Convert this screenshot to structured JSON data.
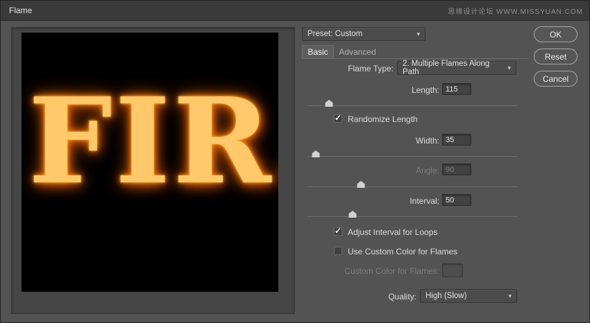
{
  "titlebar": {
    "title": "Flame",
    "watermark": "思缘设计论坛 WWW.MISSYUAN.COM"
  },
  "preview": {
    "flame_text": "FIR.."
  },
  "panel": {
    "preset": "Preset: Custom",
    "tabs": {
      "basic": "Basic",
      "advanced": "Advanced"
    },
    "flame_type": {
      "label": "Flame Type:",
      "value": "2. Multiple Flames Along Path"
    },
    "length": {
      "label": "Length:",
      "value": "115",
      "slider": 10.3
    },
    "randomize_length": {
      "label": "Randomize Length",
      "checked": true
    },
    "width": {
      "label": "Width:",
      "value": "35",
      "slider": 4
    },
    "angle": {
      "label": "Angle:",
      "value": "90",
      "slider": 25.5
    },
    "interval": {
      "label": "Interval:",
      "value": "50",
      "slider": 21.5
    },
    "adjust_interval": {
      "label": "Adjust Interval for Loops",
      "checked": true
    },
    "use_custom_color": {
      "label": "Use Custom Color for Flames",
      "checked": false
    },
    "custom_color": {
      "label": "Custom Color for Flames:"
    },
    "quality": {
      "label": "Quality:",
      "value": "High (Slow)"
    }
  },
  "buttons": {
    "ok": "OK",
    "reset": "Reset",
    "cancel": "Cancel"
  },
  "colors": {
    "flame_accent": "#f59a2c",
    "dialog_bg": "#535353"
  }
}
